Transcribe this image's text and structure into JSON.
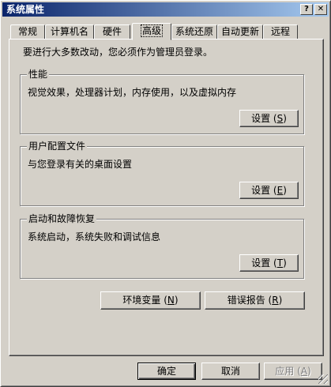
{
  "window": {
    "title": "系统属性",
    "help_glyph": "?",
    "close_glyph": "✕"
  },
  "tabs": [
    {
      "label": "常规"
    },
    {
      "label": "计算机名"
    },
    {
      "label": "硬件"
    },
    {
      "label": "高级"
    },
    {
      "label": "系统还原"
    },
    {
      "label": "自动更新"
    },
    {
      "label": "远程"
    }
  ],
  "active_tab": "高级",
  "intro_text": "要进行大多数改动，您必须作为管理员登录。",
  "groups": {
    "performance": {
      "title": "性能",
      "description": "视觉效果，处理器计划，内存使用，以及虚拟内存",
      "button": {
        "label": "设置",
        "key": "S"
      }
    },
    "profile": {
      "title": "用户配置文件",
      "description": "与您登录有关的桌面设置",
      "button": {
        "label": "设置",
        "key": "E"
      }
    },
    "recovery": {
      "title": "启动和故障恢复",
      "description": "系统启动，系统失败和调试信息",
      "button": {
        "label": "设置",
        "key": "T"
      }
    }
  },
  "env_button": {
    "label": "环境变量",
    "key": "N"
  },
  "error_button": {
    "label": "错误报告",
    "key": "R"
  },
  "footer": {
    "ok": "确定",
    "cancel": "取消",
    "apply": {
      "label": "应用",
      "key": "A"
    }
  }
}
